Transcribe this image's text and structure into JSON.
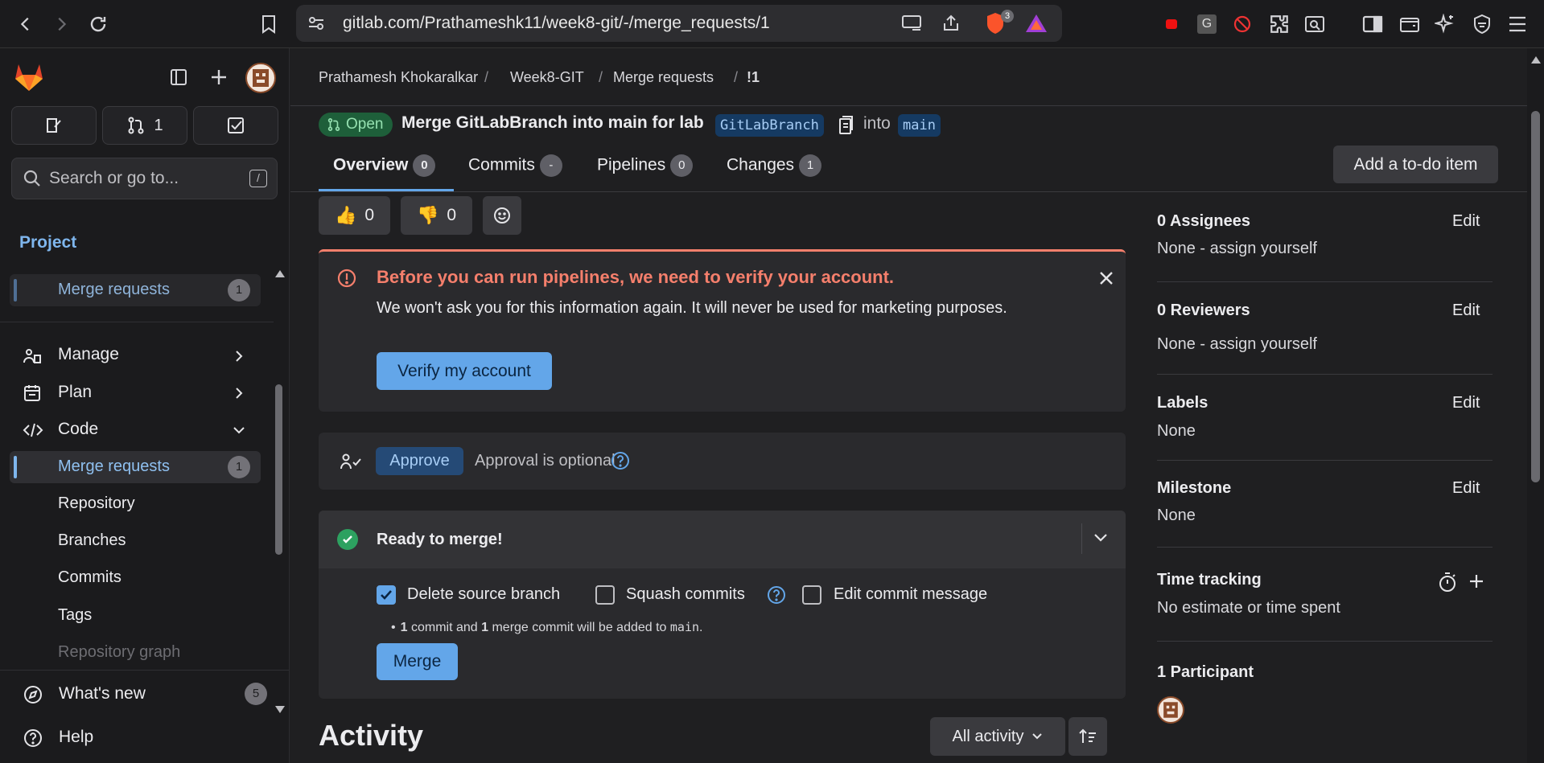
{
  "browser": {
    "url": "gitlab.com/Prathameshk11/week8-git/-/merge_requests/1",
    "brave_badge": "3"
  },
  "sidebar": {
    "mr_count_button": "1",
    "search_placeholder": "Search or go to...",
    "search_shortcut": "/",
    "section": "Project",
    "pinned_item": {
      "label": "Merge requests",
      "count": "1"
    },
    "items": [
      {
        "label": "Manage"
      },
      {
        "label": "Plan"
      },
      {
        "label": "Code"
      }
    ],
    "code_subitems": [
      {
        "label": "Merge requests",
        "count": "1"
      },
      {
        "label": "Repository"
      },
      {
        "label": "Branches"
      },
      {
        "label": "Commits"
      },
      {
        "label": "Tags"
      },
      {
        "label": "Repository graph"
      }
    ],
    "whats_new": {
      "label": "What's new",
      "count": "5"
    },
    "help": "Help"
  },
  "breadcrumb": [
    "Prathamesh Khokaralkar",
    "Week8-GIT",
    "Merge requests",
    "!1"
  ],
  "mr": {
    "status": "Open",
    "title": "Merge GitLabBranch into main for lab",
    "source_branch": "GitLabBranch",
    "into": "into",
    "target_branch": "main"
  },
  "tabs": [
    {
      "label": "Overview",
      "count": "0"
    },
    {
      "label": "Commits",
      "count": "-"
    },
    {
      "label": "Pipelines",
      "count": "0"
    },
    {
      "label": "Changes",
      "count": "1"
    }
  ],
  "todo_button": "Add a to-do item",
  "reactions": {
    "thumbs_up": "0",
    "thumbs_down": "0"
  },
  "alert": {
    "title": "Before you can run pipelines, we need to verify your account.",
    "body": "We won't ask you for this information again. It will never be used for marketing purposes.",
    "button": "Verify my account"
  },
  "approval": {
    "button": "Approve",
    "text": "Approval is optional"
  },
  "merge": {
    "title": "Ready to merge!",
    "options": [
      "Delete source branch",
      "Squash commits",
      "Edit commit message"
    ],
    "note_count1": "1",
    "note_text1": " commit and ",
    "note_count2": "1",
    "note_text2": " merge commit will be added to ",
    "note_branch": "main",
    "note_end": ".",
    "button": "Merge"
  },
  "activity": {
    "title": "Activity",
    "filter": "All activity"
  },
  "right": {
    "edit_label": "Edit",
    "assignees_title": "0 Assignees",
    "assignees_value": "None - assign yourself",
    "reviewers_title": "0 Reviewers",
    "reviewers_value": "None - assign yourself",
    "labels_title": "Labels",
    "labels_value": "None",
    "milestone_title": "Milestone",
    "milestone_value": "None",
    "time_title": "Time tracking",
    "time_value": "No estimate or time spent",
    "participants_title": "1 Participant"
  },
  "colors": {
    "accent": "#63a6e9",
    "danger": "#f57f6c",
    "success": "#2da160"
  }
}
